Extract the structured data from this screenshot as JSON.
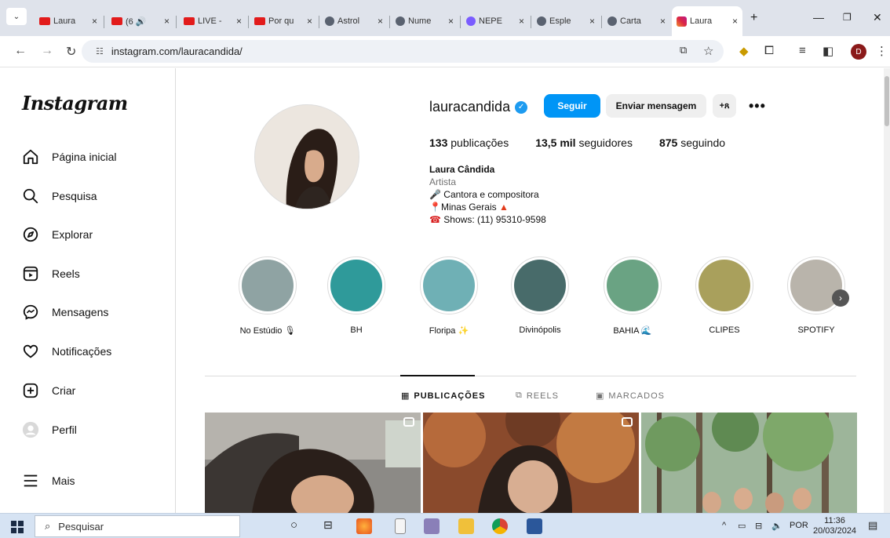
{
  "browser": {
    "tabs": [
      {
        "label": "Laura",
        "type": "youtube"
      },
      {
        "label": "(6 🔊",
        "type": "youtube"
      },
      {
        "label": "LIVE -",
        "type": "youtube"
      },
      {
        "label": "Por qu",
        "type": "youtube"
      },
      {
        "label": "Astrol",
        "type": "globe"
      },
      {
        "label": "Nume",
        "type": "globe"
      },
      {
        "label": "NEPE",
        "type": "nepe"
      },
      {
        "label": "Esple",
        "type": "globe"
      },
      {
        "label": "Carta",
        "type": "globe"
      },
      {
        "label": "Laura",
        "type": "instagram",
        "active": true
      }
    ],
    "close_glyph": "×",
    "new_tab": "+",
    "url": "instagram.com/lauracandida/",
    "profile_initial": "D"
  },
  "sidebar": {
    "logo": "Instagram",
    "items": [
      {
        "label": "Página inicial",
        "icon": "home-icon"
      },
      {
        "label": "Pesquisa",
        "icon": "search-icon"
      },
      {
        "label": "Explorar",
        "icon": "compass-icon"
      },
      {
        "label": "Reels",
        "icon": "reels-icon"
      },
      {
        "label": "Mensagens",
        "icon": "messenger-icon"
      },
      {
        "label": "Notificações",
        "icon": "heart-icon"
      },
      {
        "label": "Criar",
        "icon": "plus-square-icon"
      },
      {
        "label": "Perfil",
        "icon": "profile-avatar"
      },
      {
        "label": "Mais",
        "icon": "menu-icon"
      }
    ]
  },
  "profile": {
    "username": "lauracandida",
    "follow_label": "Seguir",
    "message_label": "Enviar mensagem",
    "suggest_label": "+ጸ",
    "more_label": "•••",
    "stats": {
      "posts_count": "133",
      "posts_label": "publicações",
      "followers_count": "13,5 mil",
      "followers_label": "seguidores",
      "following_count": "875",
      "following_label": "seguindo"
    },
    "bio": {
      "name": "Laura Cândida",
      "category": "Artista",
      "line1": "Cantora e compositora",
      "line2": "Minas Gerais",
      "line3": "Shows: (11) 95310-9598"
    }
  },
  "highlights": [
    {
      "label": "No Estúdio",
      "emoji": "🎙",
      "color": "#8fa3a3"
    },
    {
      "label": "BH",
      "emoji": "",
      "color": "#2f9a9a"
    },
    {
      "label": "Floripa",
      "emoji": "✨",
      "color": "#6fb0b5"
    },
    {
      "label": "Divinópolis",
      "emoji": "",
      "color": "#486b6a"
    },
    {
      "label": "BAHIA",
      "emoji": "🌊",
      "color": "#6aa383"
    },
    {
      "label": "CLIPES",
      "emoji": "",
      "color": "#a9a05c"
    },
    {
      "label": "SPOTIFY",
      "emoji": "",
      "color": "#b9b4ab"
    }
  ],
  "profile_tabs": [
    {
      "label": "PUBLICAÇÕES",
      "icon": "grid-icon",
      "active": true
    },
    {
      "label": "REELS",
      "icon": "reels-icon",
      "active": false
    },
    {
      "label": "MARCADOS",
      "icon": "tagged-icon",
      "active": false
    }
  ],
  "taskbar": {
    "search_label": "Pesquisar",
    "language": "POR",
    "time": "11:36",
    "date": "20/03/2024"
  }
}
